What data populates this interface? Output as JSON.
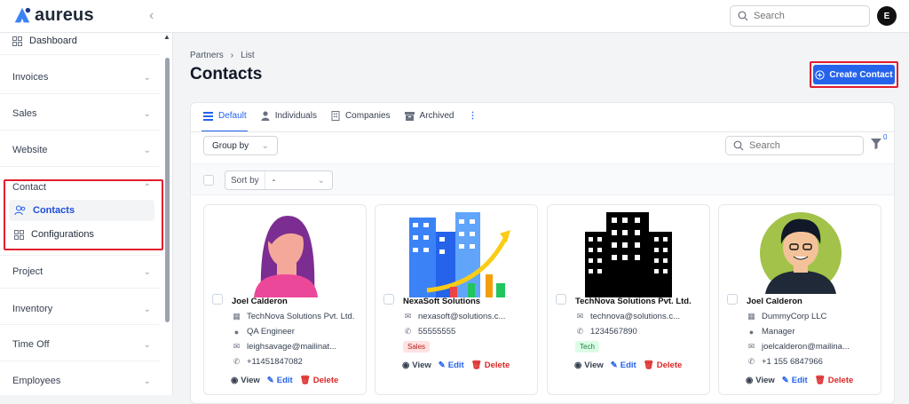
{
  "app": {
    "name": "aureus"
  },
  "topbar": {
    "search_placeholder": "Search",
    "user_initial": "E"
  },
  "sidebar": {
    "dashboard": "Dashboard",
    "sections": [
      "Invoices",
      "Sales",
      "Website",
      "Contact",
      "Project",
      "Inventory",
      "Time Off",
      "Employees"
    ],
    "contact_items": [
      {
        "label": "Contacts",
        "active": true
      },
      {
        "label": "Configurations",
        "active": false
      }
    ]
  },
  "breadcrumb": [
    "Partners",
    "List"
  ],
  "page": {
    "title": "Contacts",
    "create_label": "Create Contact"
  },
  "tabs": [
    {
      "label": "Default",
      "icon": "list-icon",
      "active": true
    },
    {
      "label": "Individuals",
      "icon": "person-icon",
      "active": false
    },
    {
      "label": "Companies",
      "icon": "building-icon",
      "active": false
    },
    {
      "label": "Archived",
      "icon": "archive-icon",
      "active": false
    }
  ],
  "toolbar": {
    "group_by": "Group by",
    "search_placeholder": "Search",
    "filter_count": "0",
    "sort_label": "Sort by",
    "sort_value": "-"
  },
  "actions": {
    "view": "View",
    "edit": "Edit",
    "delete": "Delete"
  },
  "cards": [
    {
      "name": "Joel Calderon",
      "company": "TechNova Solutions Pvt. Ltd.",
      "job": "QA Engineer",
      "email": "leighsavage@mailinat...",
      "phone": "+11451847082",
      "tag": null,
      "image": "woman-avatar-illustration"
    },
    {
      "name": "NexaSoft Solutions",
      "company": null,
      "job": null,
      "email": "nexasoft@solutions.c...",
      "phone": "55555555",
      "tag": "Sales",
      "image": "office-building-growth-illustration"
    },
    {
      "name": "TechNova Solutions Pvt. Ltd.",
      "company": null,
      "job": null,
      "email": "technova@solutions.c...",
      "phone": "1234567890",
      "tag": "Tech",
      "image": "black-buildings-icon"
    },
    {
      "name": "Joel Calderon",
      "company": "DummyCorp LLC",
      "job": "Manager",
      "email": "joelcalderon@mailina...",
      "phone": "+1 155 6847966",
      "tag": null,
      "image": "man-avatar-illustration"
    }
  ],
  "colors": {
    "primary": "#2563eb",
    "highlight_box": "#e11d2e",
    "delete": "#dc2626"
  }
}
